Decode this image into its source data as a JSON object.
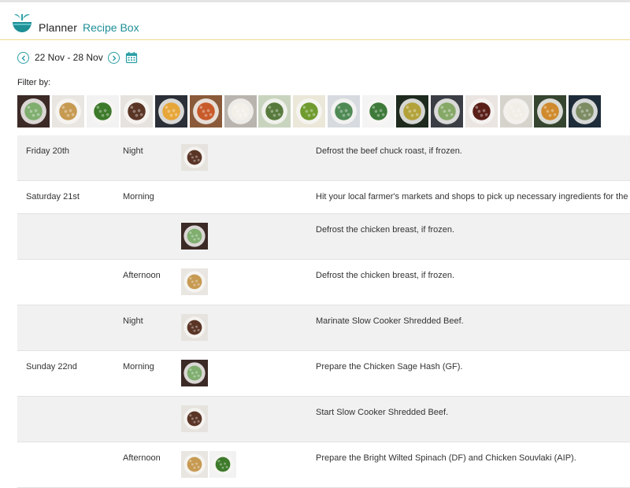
{
  "header": {
    "brand": "Planner",
    "nav_link": "Recipe Box",
    "accent": "#1f8f96"
  },
  "datebar": {
    "range": "22 Nov - 28 Nov",
    "prev_icon": "chevron-left-circle-icon",
    "next_icon": "chevron-right-circle-icon",
    "calendar_icon": "calendar-icon"
  },
  "filter": {
    "label": "Filter by:",
    "recipes": [
      {
        "icon": "salad-bowl-thumb",
        "base": "#3b2a26",
        "food": "#7fae6f"
      },
      {
        "icon": "souvlaki-plate-thumb",
        "base": "#e9e6e1",
        "food": "#c79a52"
      },
      {
        "icon": "greens-board-thumb",
        "base": "#f2f2f2",
        "food": "#3d7a2a"
      },
      {
        "icon": "shredded-beef-bowl-thumb",
        "base": "#e6e3df",
        "food": "#5a3526"
      },
      {
        "icon": "fries-thumb",
        "base": "#2b2f37",
        "food": "#e7a63a"
      },
      {
        "icon": "curry-bowl-thumb",
        "base": "#8a5a3a",
        "food": "#c85a2a"
      },
      {
        "icon": "rice-plate-thumb",
        "base": "#b9b4ae",
        "food": "#f3f0ea"
      },
      {
        "icon": "herbs-thumb",
        "base": "#c9d4bf",
        "food": "#577a3c"
      },
      {
        "icon": "broccoli-bowl-thumb",
        "base": "#ebe7d9",
        "food": "#6f9b2f"
      },
      {
        "icon": "salmon-salad-thumb",
        "base": "#d7dbe0",
        "food": "#4f8a55"
      },
      {
        "icon": "spinach-bowl-thumb",
        "base": "#f4f4f4",
        "food": "#3e7a3a"
      },
      {
        "icon": "veg-stir-thumb",
        "base": "#1e2a1e",
        "food": "#b3a23a"
      },
      {
        "icon": "kale-bowl-thumb",
        "base": "#3b3f45",
        "food": "#86a867"
      },
      {
        "icon": "meatball-thumb",
        "base": "#ebe5e2",
        "food": "#5a1f18"
      },
      {
        "icon": "soup-bowl-thumb",
        "base": "#d6d3cd",
        "food": "#f1eee7"
      },
      {
        "icon": "roast-veg-thumb",
        "base": "#35452f",
        "food": "#d08a2d"
      },
      {
        "icon": "gift-box-thumb",
        "base": "#1e2c3a",
        "food": "#7d8c63"
      }
    ]
  },
  "schedule": {
    "rows": [
      {
        "day": "Friday 20th",
        "time": "Night",
        "task": "Defrost the beef chuck roast, if frozen.",
        "images": [
          "shredded-beef-bowl-thumb"
        ]
      },
      {
        "day": "Saturday 21st",
        "time": "Morning",
        "task": "Hit your local farmer's markets and shops to pick up necessary ingredients for the week.",
        "images": []
      },
      {
        "day": "",
        "time": "",
        "task": "Defrost the chicken breast, if frozen.",
        "images": [
          "salad-bowl-thumb"
        ]
      },
      {
        "day": "",
        "time": "Afternoon",
        "task": "Defrost the chicken breast, if frozen.",
        "images": [
          "souvlaki-plate-thumb"
        ]
      },
      {
        "day": "",
        "time": "Night",
        "task": "Marinate Slow Cooker Shredded Beef.",
        "images": [
          "shredded-beef-bowl-thumb"
        ]
      },
      {
        "day": "Sunday 22nd",
        "time": "Morning",
        "task": "Prepare the Chicken Sage Hash (GF).",
        "images": [
          "salad-bowl-thumb"
        ]
      },
      {
        "day": "",
        "time": "",
        "task": "Start Slow Cooker Shredded Beef.",
        "images": [
          "shredded-beef-bowl-thumb"
        ]
      },
      {
        "day": "",
        "time": "Afternoon",
        "task": "Prepare the Bright Wilted Spinach (DF) and Chicken Souvlaki (AIP).",
        "images": [
          "souvlaki-plate-thumb",
          "greens-board-thumb"
        ]
      }
    ]
  }
}
